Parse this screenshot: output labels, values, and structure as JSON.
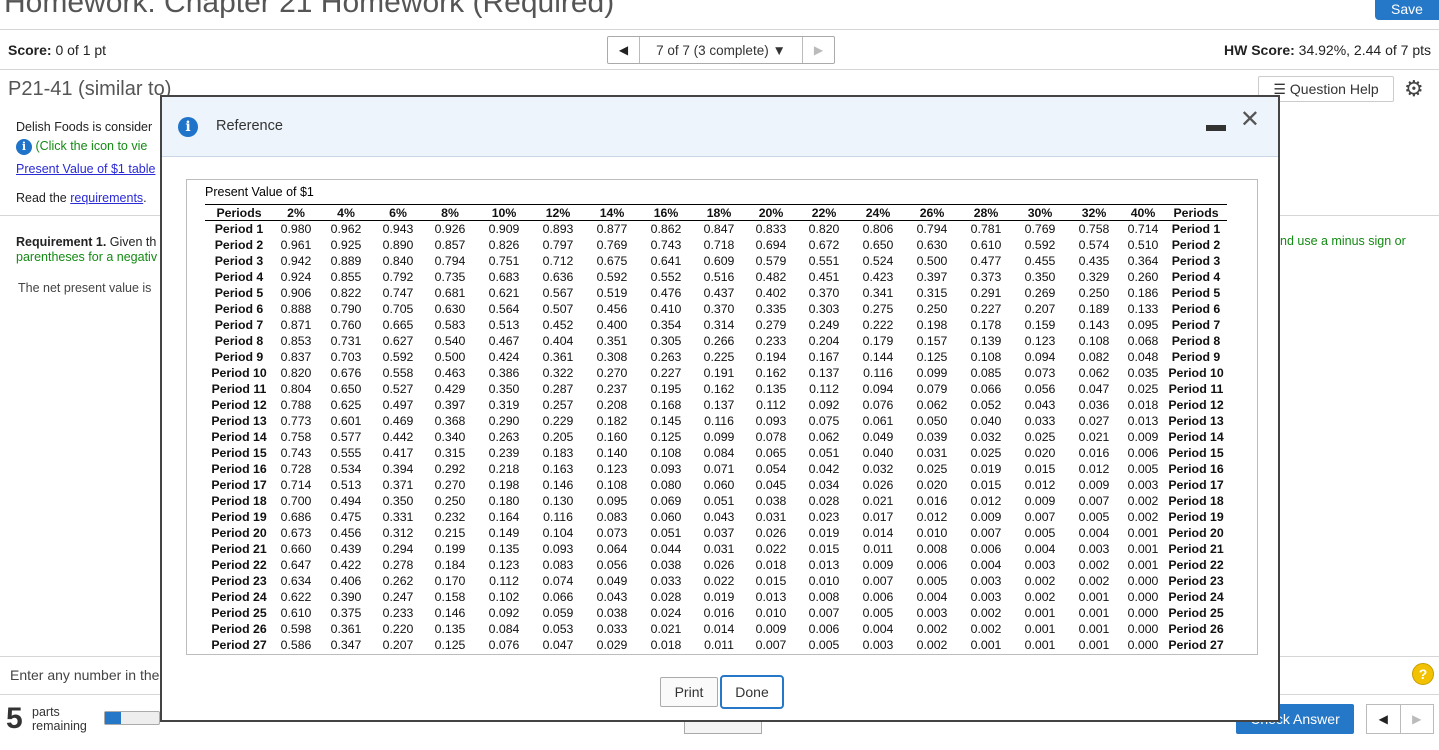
{
  "header": {
    "title": "Homework: Chapter 21 Homework (Required)",
    "save_label": "Save",
    "score_label": "Score:",
    "score_value": "0 of 1 pt",
    "nav_text": "7 of 7 (3 complete)",
    "hw_score_label": "HW Score:",
    "hw_score_value": "34.92%, 2.44 of 7 pts"
  },
  "question": {
    "id": "P21-41 (similar to)",
    "help_label": "Question Help",
    "line1": "Delish Foods is consider",
    "info_hint": "(Click the icon to vie",
    "pv_link": "Present Value of $1 table",
    "read_prefix": "Read the ",
    "read_link": "requirements",
    "read_suffix": ".",
    "req_label": "Requirement 1.",
    "req_text": " Given th",
    "req_line2": "parentheses for a negativ",
    "req_right": "nd use a minus sign or",
    "npv_text": "The net present value is",
    "enter_text": "Enter any number in the"
  },
  "footer": {
    "parts_number": "5",
    "parts_line1": "parts",
    "parts_line2": "remaining",
    "progress_fraction": 0.3,
    "check_label": "Check Answer"
  },
  "modal": {
    "title": "Reference",
    "caption": "Present Value of $1",
    "print_label": "Print",
    "done_label": "Done",
    "headers": [
      "Periods",
      "2%",
      "4%",
      "6%",
      "8%",
      "10%",
      "12%",
      "14%",
      "16%",
      "18%",
      "20%",
      "22%",
      "24%",
      "26%",
      "28%",
      "30%",
      "32%",
      "40%",
      "Periods"
    ],
    "rows": [
      [
        "Period 1",
        "0.980",
        "0.962",
        "0.943",
        "0.926",
        "0.909",
        "0.893",
        "0.877",
        "0.862",
        "0.847",
        "0.833",
        "0.820",
        "0.806",
        "0.794",
        "0.781",
        "0.769",
        "0.758",
        "0.714",
        "Period 1"
      ],
      [
        "Period 2",
        "0.961",
        "0.925",
        "0.890",
        "0.857",
        "0.826",
        "0.797",
        "0.769",
        "0.743",
        "0.718",
        "0.694",
        "0.672",
        "0.650",
        "0.630",
        "0.610",
        "0.592",
        "0.574",
        "0.510",
        "Period 2"
      ],
      [
        "Period 3",
        "0.942",
        "0.889",
        "0.840",
        "0.794",
        "0.751",
        "0.712",
        "0.675",
        "0.641",
        "0.609",
        "0.579",
        "0.551",
        "0.524",
        "0.500",
        "0.477",
        "0.455",
        "0.435",
        "0.364",
        "Period 3"
      ],
      [
        "Period 4",
        "0.924",
        "0.855",
        "0.792",
        "0.735",
        "0.683",
        "0.636",
        "0.592",
        "0.552",
        "0.516",
        "0.482",
        "0.451",
        "0.423",
        "0.397",
        "0.373",
        "0.350",
        "0.329",
        "0.260",
        "Period 4"
      ],
      [
        "Period 5",
        "0.906",
        "0.822",
        "0.747",
        "0.681",
        "0.621",
        "0.567",
        "0.519",
        "0.476",
        "0.437",
        "0.402",
        "0.370",
        "0.341",
        "0.315",
        "0.291",
        "0.269",
        "0.250",
        "0.186",
        "Period 5"
      ],
      [
        "Period 6",
        "0.888",
        "0.790",
        "0.705",
        "0.630",
        "0.564",
        "0.507",
        "0.456",
        "0.410",
        "0.370",
        "0.335",
        "0.303",
        "0.275",
        "0.250",
        "0.227",
        "0.207",
        "0.189",
        "0.133",
        "Period 6"
      ],
      [
        "Period 7",
        "0.871",
        "0.760",
        "0.665",
        "0.583",
        "0.513",
        "0.452",
        "0.400",
        "0.354",
        "0.314",
        "0.279",
        "0.249",
        "0.222",
        "0.198",
        "0.178",
        "0.159",
        "0.143",
        "0.095",
        "Period 7"
      ],
      [
        "Period 8",
        "0.853",
        "0.731",
        "0.627",
        "0.540",
        "0.467",
        "0.404",
        "0.351",
        "0.305",
        "0.266",
        "0.233",
        "0.204",
        "0.179",
        "0.157",
        "0.139",
        "0.123",
        "0.108",
        "0.068",
        "Period 8"
      ],
      [
        "Period 9",
        "0.837",
        "0.703",
        "0.592",
        "0.500",
        "0.424",
        "0.361",
        "0.308",
        "0.263",
        "0.225",
        "0.194",
        "0.167",
        "0.144",
        "0.125",
        "0.108",
        "0.094",
        "0.082",
        "0.048",
        "Period 9"
      ],
      [
        "Period 10",
        "0.820",
        "0.676",
        "0.558",
        "0.463",
        "0.386",
        "0.322",
        "0.270",
        "0.227",
        "0.191",
        "0.162",
        "0.137",
        "0.116",
        "0.099",
        "0.085",
        "0.073",
        "0.062",
        "0.035",
        "Period 10"
      ],
      [
        "Period 11",
        "0.804",
        "0.650",
        "0.527",
        "0.429",
        "0.350",
        "0.287",
        "0.237",
        "0.195",
        "0.162",
        "0.135",
        "0.112",
        "0.094",
        "0.079",
        "0.066",
        "0.056",
        "0.047",
        "0.025",
        "Period 11"
      ],
      [
        "Period 12",
        "0.788",
        "0.625",
        "0.497",
        "0.397",
        "0.319",
        "0.257",
        "0.208",
        "0.168",
        "0.137",
        "0.112",
        "0.092",
        "0.076",
        "0.062",
        "0.052",
        "0.043",
        "0.036",
        "0.018",
        "Period 12"
      ],
      [
        "Period 13",
        "0.773",
        "0.601",
        "0.469",
        "0.368",
        "0.290",
        "0.229",
        "0.182",
        "0.145",
        "0.116",
        "0.093",
        "0.075",
        "0.061",
        "0.050",
        "0.040",
        "0.033",
        "0.027",
        "0.013",
        "Period 13"
      ],
      [
        "Period 14",
        "0.758",
        "0.577",
        "0.442",
        "0.340",
        "0.263",
        "0.205",
        "0.160",
        "0.125",
        "0.099",
        "0.078",
        "0.062",
        "0.049",
        "0.039",
        "0.032",
        "0.025",
        "0.021",
        "0.009",
        "Period 14"
      ],
      [
        "Period 15",
        "0.743",
        "0.555",
        "0.417",
        "0.315",
        "0.239",
        "0.183",
        "0.140",
        "0.108",
        "0.084",
        "0.065",
        "0.051",
        "0.040",
        "0.031",
        "0.025",
        "0.020",
        "0.016",
        "0.006",
        "Period 15"
      ],
      [
        "Period 16",
        "0.728",
        "0.534",
        "0.394",
        "0.292",
        "0.218",
        "0.163",
        "0.123",
        "0.093",
        "0.071",
        "0.054",
        "0.042",
        "0.032",
        "0.025",
        "0.019",
        "0.015",
        "0.012",
        "0.005",
        "Period 16"
      ],
      [
        "Period 17",
        "0.714",
        "0.513",
        "0.371",
        "0.270",
        "0.198",
        "0.146",
        "0.108",
        "0.080",
        "0.060",
        "0.045",
        "0.034",
        "0.026",
        "0.020",
        "0.015",
        "0.012",
        "0.009",
        "0.003",
        "Period 17"
      ],
      [
        "Period 18",
        "0.700",
        "0.494",
        "0.350",
        "0.250",
        "0.180",
        "0.130",
        "0.095",
        "0.069",
        "0.051",
        "0.038",
        "0.028",
        "0.021",
        "0.016",
        "0.012",
        "0.009",
        "0.007",
        "0.002",
        "Period 18"
      ],
      [
        "Period 19",
        "0.686",
        "0.475",
        "0.331",
        "0.232",
        "0.164",
        "0.116",
        "0.083",
        "0.060",
        "0.043",
        "0.031",
        "0.023",
        "0.017",
        "0.012",
        "0.009",
        "0.007",
        "0.005",
        "0.002",
        "Period 19"
      ],
      [
        "Period 20",
        "0.673",
        "0.456",
        "0.312",
        "0.215",
        "0.149",
        "0.104",
        "0.073",
        "0.051",
        "0.037",
        "0.026",
        "0.019",
        "0.014",
        "0.010",
        "0.007",
        "0.005",
        "0.004",
        "0.001",
        "Period 20"
      ],
      [
        "Period 21",
        "0.660",
        "0.439",
        "0.294",
        "0.199",
        "0.135",
        "0.093",
        "0.064",
        "0.044",
        "0.031",
        "0.022",
        "0.015",
        "0.011",
        "0.008",
        "0.006",
        "0.004",
        "0.003",
        "0.001",
        "Period 21"
      ],
      [
        "Period 22",
        "0.647",
        "0.422",
        "0.278",
        "0.184",
        "0.123",
        "0.083",
        "0.056",
        "0.038",
        "0.026",
        "0.018",
        "0.013",
        "0.009",
        "0.006",
        "0.004",
        "0.003",
        "0.002",
        "0.001",
        "Period 22"
      ],
      [
        "Period 23",
        "0.634",
        "0.406",
        "0.262",
        "0.170",
        "0.112",
        "0.074",
        "0.049",
        "0.033",
        "0.022",
        "0.015",
        "0.010",
        "0.007",
        "0.005",
        "0.003",
        "0.002",
        "0.002",
        "0.000",
        "Period 23"
      ],
      [
        "Period 24",
        "0.622",
        "0.390",
        "0.247",
        "0.158",
        "0.102",
        "0.066",
        "0.043",
        "0.028",
        "0.019",
        "0.013",
        "0.008",
        "0.006",
        "0.004",
        "0.003",
        "0.002",
        "0.001",
        "0.000",
        "Period 24"
      ],
      [
        "Period 25",
        "0.610",
        "0.375",
        "0.233",
        "0.146",
        "0.092",
        "0.059",
        "0.038",
        "0.024",
        "0.016",
        "0.010",
        "0.007",
        "0.005",
        "0.003",
        "0.002",
        "0.001",
        "0.001",
        "0.000",
        "Period 25"
      ],
      [
        "Period 26",
        "0.598",
        "0.361",
        "0.220",
        "0.135",
        "0.084",
        "0.053",
        "0.033",
        "0.021",
        "0.014",
        "0.009",
        "0.006",
        "0.004",
        "0.002",
        "0.002",
        "0.001",
        "0.001",
        "0.000",
        "Period 26"
      ],
      [
        "Period 27",
        "0.586",
        "0.347",
        "0.207",
        "0.125",
        "0.076",
        "0.047",
        "0.029",
        "0.018",
        "0.011",
        "0.007",
        "0.005",
        "0.003",
        "0.002",
        "0.001",
        "0.001",
        "0.001",
        "0.000",
        "Period 27"
      ]
    ]
  }
}
